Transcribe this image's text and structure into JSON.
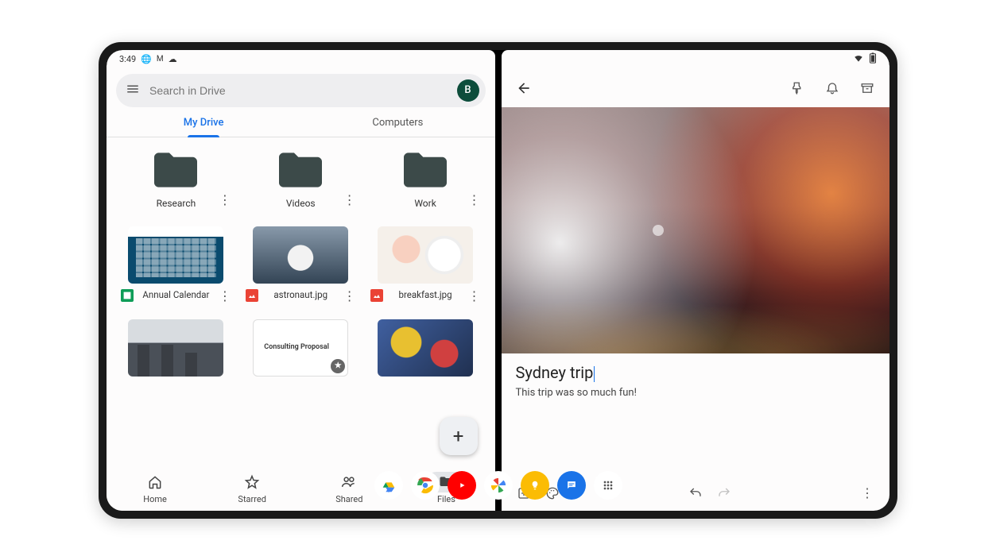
{
  "status_bar": {
    "time": "3:49",
    "left_icons": [
      "globe-icon",
      "gmail-icon",
      "cloud-icon"
    ],
    "right_icons": [
      "wifi-icon",
      "battery-icon"
    ]
  },
  "drive": {
    "search_placeholder": "Search in Drive",
    "avatar_initial": "B",
    "tabs": [
      {
        "label": "My Drive",
        "active": true
      },
      {
        "label": "Computers",
        "active": false
      }
    ],
    "folders": [
      {
        "name": "Research"
      },
      {
        "name": "Videos"
      },
      {
        "name": "Work"
      }
    ],
    "files_row1": [
      {
        "name": "Annual Calendar",
        "type": "sheets",
        "thumb": "calendar"
      },
      {
        "name": "astronaut.jpg",
        "type": "image",
        "thumb": "astronaut"
      },
      {
        "name": "breakfast.jpg",
        "type": "image",
        "thumb": "breakfast"
      }
    ],
    "files_row2": [
      {
        "name": "",
        "type": "image",
        "thumb": "city"
      },
      {
        "name": "",
        "type": "slides",
        "thumb": "consulting",
        "thumb_text": "Consulting Proposal",
        "starred": true
      },
      {
        "name": "",
        "type": "image",
        "thumb": "abstract"
      }
    ],
    "nav": [
      {
        "label": "Home",
        "icon": "home-icon"
      },
      {
        "label": "Starred",
        "icon": "star-icon"
      },
      {
        "label": "Shared",
        "icon": "people-icon"
      },
      {
        "label": "Files",
        "icon": "folder-icon",
        "active": true
      }
    ]
  },
  "keep": {
    "title": "Sydney trip",
    "body": "This trip was so much fun!",
    "toolbar_icons": [
      "pin-icon",
      "reminder-icon",
      "archive-icon"
    ],
    "bottom_icons_left": [
      "add-box-icon",
      "palette-icon"
    ],
    "bottom_icons_center": [
      "undo-icon",
      "redo-icon"
    ],
    "bottom_icons_right": [
      "more-vert-icon"
    ]
  },
  "taskbar": {
    "apps": [
      "drive-app",
      "chrome-app",
      "youtube-app",
      "photos-app",
      "keep-app",
      "messages-app",
      "all-apps"
    ]
  }
}
